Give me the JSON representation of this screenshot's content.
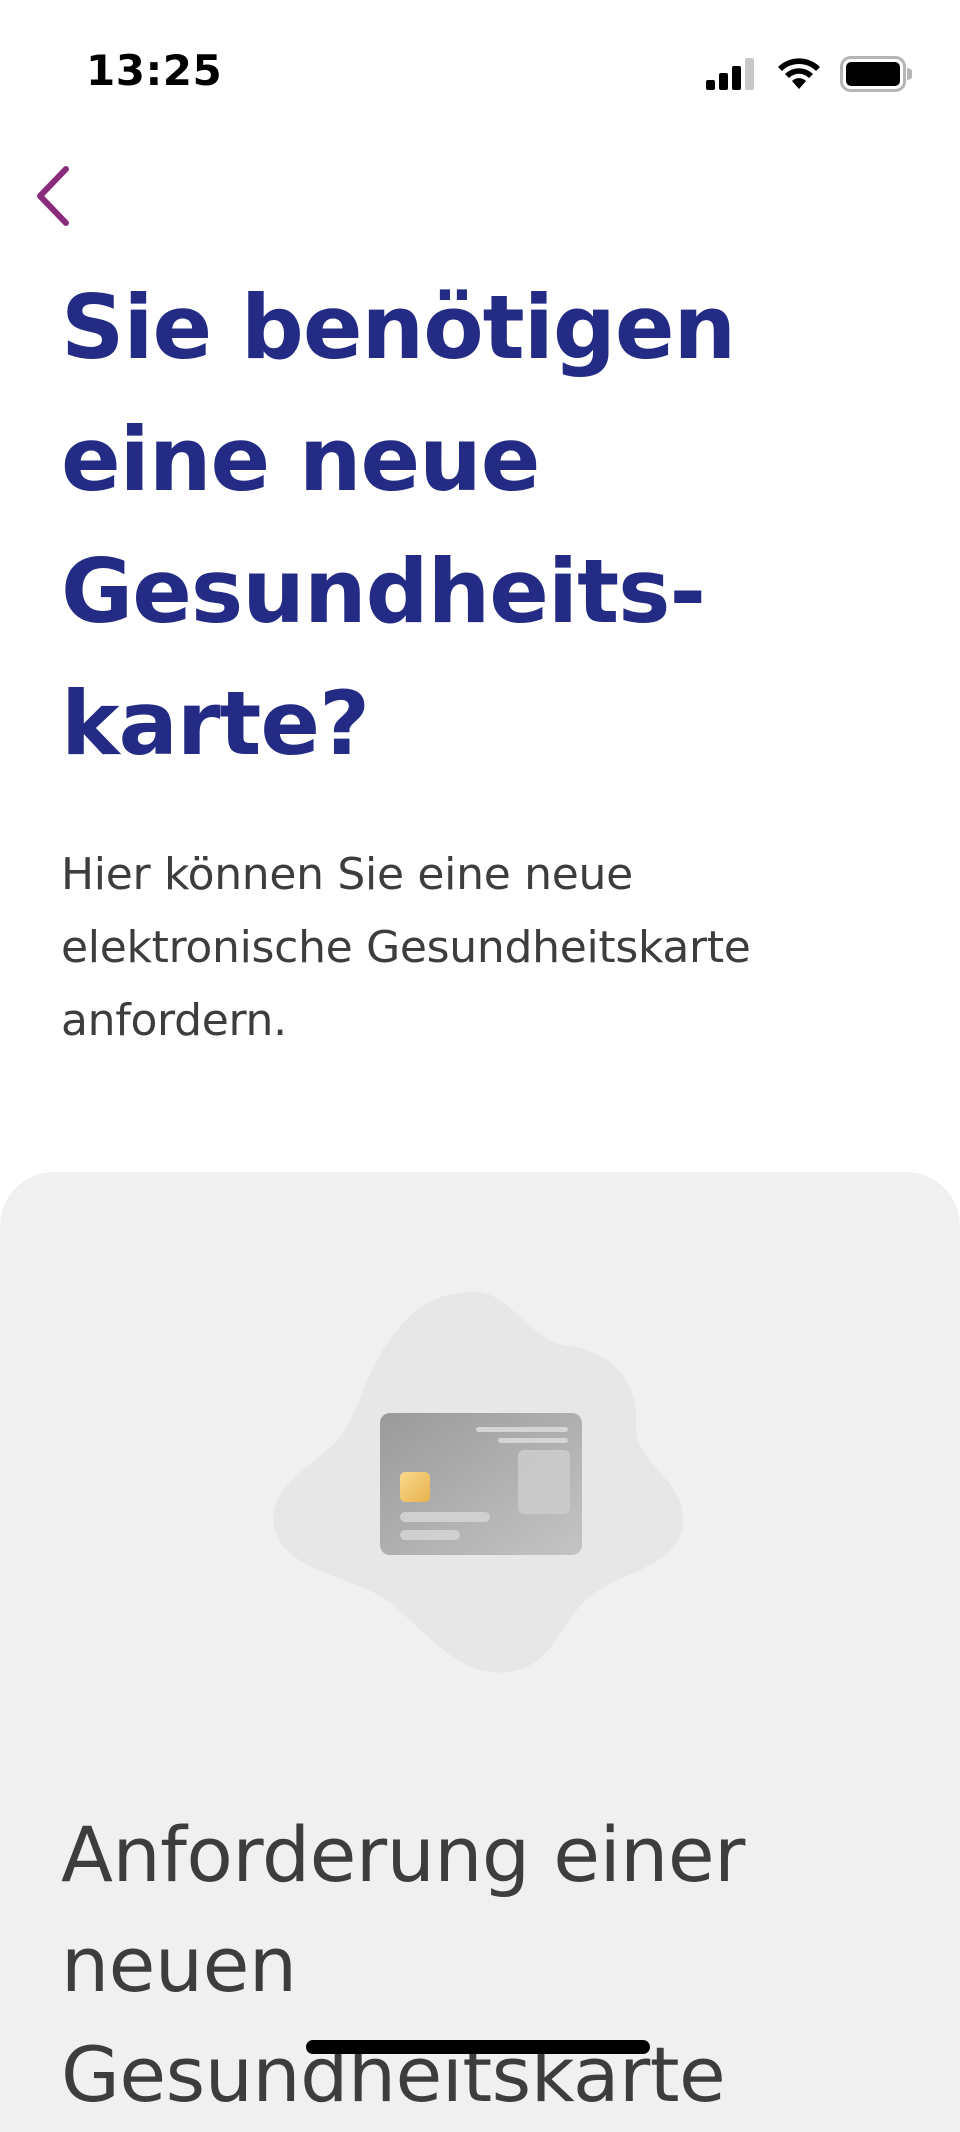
{
  "status_bar": {
    "time": "13:25",
    "icons": [
      "signal-icon",
      "wifi-icon",
      "battery-icon"
    ]
  },
  "navigation": {
    "back_icon": "chevron-left-icon"
  },
  "colors": {
    "title": "#242b85",
    "accent": "#8a2c7c",
    "body_text": "#3d3d3d",
    "panel_background": "#f0f0f0"
  },
  "header": {
    "title": "Sie benötigen eine neue Gesundheits-karte?",
    "intro": "Hier können Sie eine neue elektronische Gesundheitskarte anfordern."
  },
  "panel": {
    "illustration_icon": "health-card-icon",
    "title": "Anforderung einer neuen Gesundheitskarte"
  }
}
